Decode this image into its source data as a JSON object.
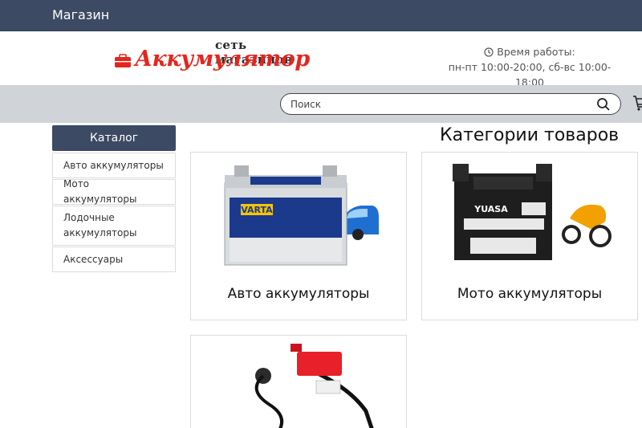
{
  "topbar": {
    "title": "Магазин"
  },
  "logo": {
    "tagline": "сеть магазинов",
    "brand": "Аккумулятор"
  },
  "hours": {
    "label": "Время работы:",
    "schedule": "пн-пт 10:00-20:00, сб-вс 10:00-18:00"
  },
  "search": {
    "placeholder": "Поиск"
  },
  "catalog": {
    "heading": "Каталог",
    "items": [
      {
        "label": "Авто аккумуляторы"
      },
      {
        "label": "Мото аккумуляторы"
      },
      {
        "label": "Лодочные аккумуляторы"
      },
      {
        "label": "Аксессуары"
      }
    ]
  },
  "main": {
    "title": "Категории товаров",
    "cards": [
      {
        "label": "Авто аккумуляторы",
        "image_text": "VARTA"
      },
      {
        "label": "Мото аккумуляторы",
        "image_text": "YUASA"
      },
      {
        "label": "",
        "image_text": ""
      }
    ]
  },
  "colors": {
    "header_bg": "#3c4a63",
    "brand_red": "#e4261f",
    "search_strip": "#d0d3d8"
  }
}
